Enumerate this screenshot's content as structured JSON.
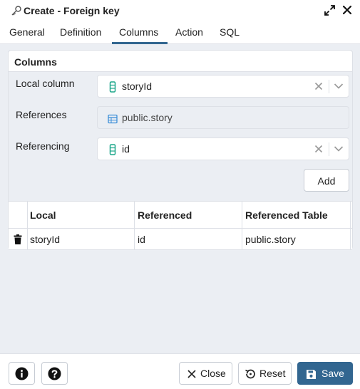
{
  "window": {
    "title": "Create - Foreign key"
  },
  "tabs": [
    {
      "label": "General"
    },
    {
      "label": "Definition"
    },
    {
      "label": "Columns"
    },
    {
      "label": "Action"
    },
    {
      "label": "SQL"
    }
  ],
  "active_tab": "Columns",
  "columns_panel": {
    "header": "Columns",
    "local_column": {
      "label": "Local column",
      "value": "storyId",
      "icon": "column-icon"
    },
    "references": {
      "label": "References",
      "value": "public.story",
      "icon": "table-icon"
    },
    "referencing": {
      "label": "Referencing",
      "value": "id",
      "icon": "column-icon"
    },
    "add_label": "Add"
  },
  "grid": {
    "headers": [
      "Local",
      "Referenced",
      "Referenced Table"
    ],
    "rows": [
      {
        "local": "storyId",
        "referenced": "id",
        "table": "public.story"
      }
    ]
  },
  "footer": {
    "close_label": "Close",
    "reset_label": "Reset",
    "save_label": "Save"
  },
  "colors": {
    "accent": "#326690",
    "column_icon": "#1ba689",
    "table_icon": "#3d8fd8"
  }
}
